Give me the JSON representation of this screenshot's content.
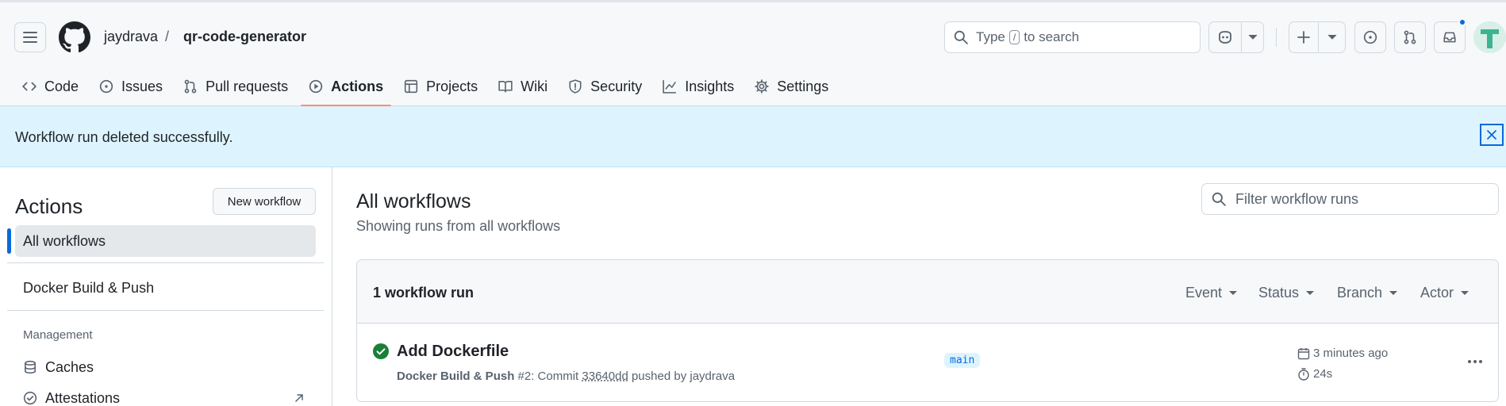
{
  "header": {
    "owner": "jaydrava",
    "separator": "/",
    "repo": "qr-code-generator",
    "search": {
      "prefix": "Type",
      "key": "/",
      "suffix": "to search"
    }
  },
  "nav": {
    "tabs": [
      {
        "label": "Code",
        "icon": "code-icon"
      },
      {
        "label": "Issues",
        "icon": "issue-icon"
      },
      {
        "label": "Pull requests",
        "icon": "pull-request-icon"
      },
      {
        "label": "Actions",
        "icon": "play-icon",
        "active": true
      },
      {
        "label": "Projects",
        "icon": "table-icon"
      },
      {
        "label": "Wiki",
        "icon": "book-icon"
      },
      {
        "label": "Security",
        "icon": "shield-icon"
      },
      {
        "label": "Insights",
        "icon": "graph-icon"
      },
      {
        "label": "Settings",
        "icon": "gear-icon"
      }
    ]
  },
  "flash": {
    "message": "Workflow run deleted successfully."
  },
  "sidebar": {
    "title": "Actions",
    "new_workflow": "New workflow",
    "items": [
      {
        "label": "All workflows",
        "selected": true
      },
      {
        "label": "Docker Build & Push"
      }
    ],
    "management_heading": "Management",
    "management": [
      {
        "label": "Caches",
        "icon": "database-icon"
      },
      {
        "label": "Attestations",
        "icon": "verified-icon"
      }
    ]
  },
  "main": {
    "title": "All workflows",
    "subtitle": "Showing runs from all workflows",
    "filter_placeholder": "Filter workflow runs",
    "runs_count": "1 workflow run",
    "filters": [
      "Event",
      "Status",
      "Branch",
      "Actor"
    ],
    "runs": [
      {
        "title": "Add Dockerfile",
        "workflow": "Docker Build & Push",
        "number": "#2: Commit",
        "sha": "33640dd",
        "pushed_by": "pushed by jaydrava",
        "branch": "main",
        "when": "3 minutes ago",
        "duration": "24s",
        "status": "success"
      }
    ]
  },
  "colors": {
    "accent": "#0969da",
    "active_tab_underline": "#fd8c73",
    "success": "#1a7f37",
    "flash_bg": "#ddf4ff"
  }
}
